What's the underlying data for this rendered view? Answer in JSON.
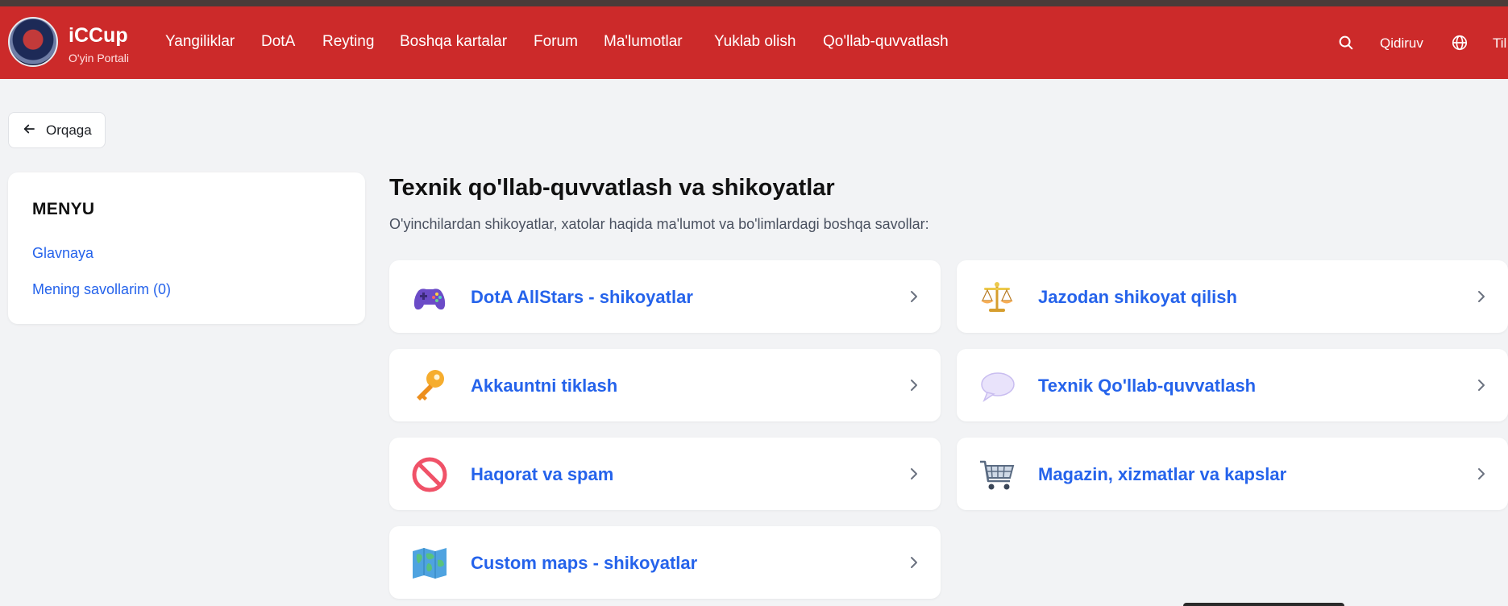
{
  "brand": {
    "title": "iCCup",
    "subtitle": "O'yin Portali"
  },
  "nav": {
    "items": [
      "Yangiliklar",
      "DotA",
      "Reyting",
      "Boshqa kartalar",
      "Forum",
      "Ma'lumotlar",
      "Yuklab olish",
      "Qo'llab-quvvatlash"
    ],
    "search_label": "Qidiruv",
    "lang_label": "Til"
  },
  "back": {
    "label": "Orqaga"
  },
  "menu": {
    "title": "MENYU",
    "links": [
      "Glavnaya",
      "Mening savollarim (0)"
    ]
  },
  "main": {
    "title": "Texnik qo'llab-quvvatlash va shikoyatlar",
    "description": "O'yinchilardan shikoyatlar, xatolar haqida ma'lumot va bo'limlardagi boshqa savollar:"
  },
  "categories": [
    {
      "label": "DotA AllStars - shikoyatlar",
      "icon": "game-controller-icon"
    },
    {
      "label": "Jazodan shikoyat qilish",
      "icon": "balance-scale-icon"
    },
    {
      "label": "Akkauntni tiklash",
      "icon": "key-icon"
    },
    {
      "label": "Texnik Qo'llab-quvvatlash",
      "icon": "speech-bubble-icon"
    },
    {
      "label": "Haqorat va spam",
      "icon": "prohibited-icon"
    },
    {
      "label": "Magazin, xizmatlar va kapslar",
      "icon": "shopping-cart-icon"
    },
    {
      "label": "Custom maps - shikoyatlar",
      "icon": "world-map-icon"
    }
  ],
  "colors": {
    "navbar": "#cc2a2a",
    "link": "#2563eb",
    "background": "#f2f3f5"
  }
}
